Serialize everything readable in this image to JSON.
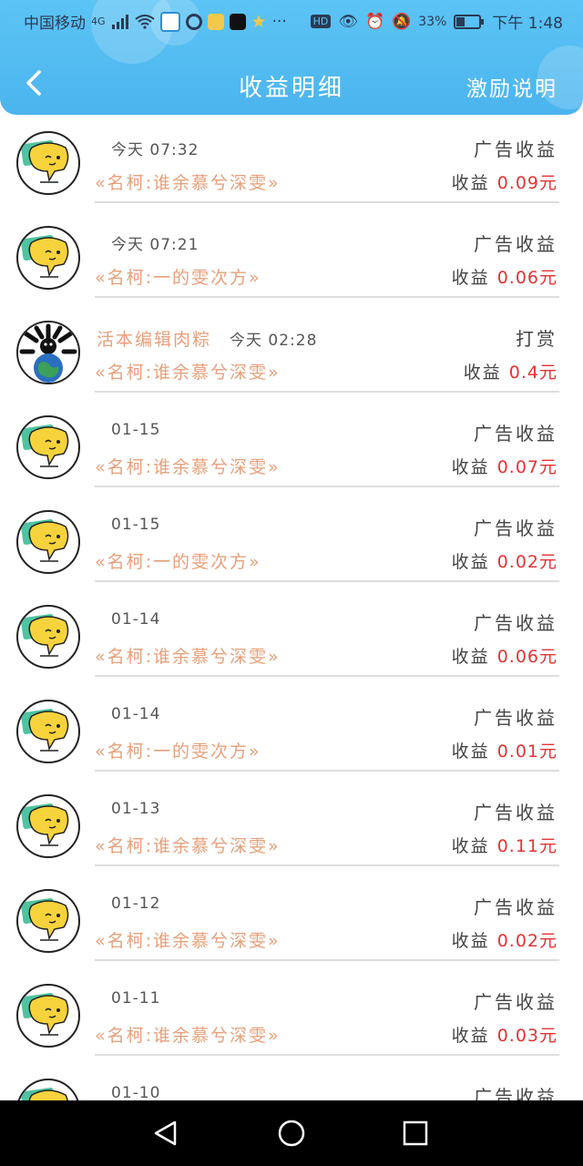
{
  "status_bar": {
    "carrier": "中国移动",
    "network": "4G",
    "battery": "33%",
    "time": "下午 1:48",
    "hd_badge": "HD"
  },
  "header": {
    "title": "收益明细",
    "explain_link": "激励说明",
    "back_icon": "chevron-left-icon",
    "color_top": "#5cc4f4",
    "color_bottom": "#4bb4ee"
  },
  "income_label": "收益",
  "amount_color": "#e23434",
  "book_color": "#e6a07a",
  "entries": [
    {
      "user": "",
      "time": "今天 07:32",
      "type": "广告收益",
      "book": "«名柯:谁余慕兮深雯»",
      "amount": "0.09元",
      "avatar": "chat-bubble-avatar"
    },
    {
      "user": "",
      "time": "今天 07:21",
      "type": "广告收益",
      "book": "«名柯:一的雯次方»",
      "amount": "0.06元",
      "avatar": "chat-bubble-avatar"
    },
    {
      "user": "活本编辑肉粽",
      "time": "今天 02:28",
      "type": "打赏",
      "book": "«名柯:谁余慕兮深雯»",
      "amount": "0.4元",
      "avatar": "earth-avatar"
    },
    {
      "user": "",
      "time": "01-15",
      "type": "广告收益",
      "book": "«名柯:谁余慕兮深雯»",
      "amount": "0.07元",
      "avatar": "chat-bubble-avatar"
    },
    {
      "user": "",
      "time": "01-15",
      "type": "广告收益",
      "book": "«名柯:一的雯次方»",
      "amount": "0.02元",
      "avatar": "chat-bubble-avatar"
    },
    {
      "user": "",
      "time": "01-14",
      "type": "广告收益",
      "book": "«名柯:谁余慕兮深雯»",
      "amount": "0.06元",
      "avatar": "chat-bubble-avatar"
    },
    {
      "user": "",
      "time": "01-14",
      "type": "广告收益",
      "book": "«名柯:一的雯次方»",
      "amount": "0.01元",
      "avatar": "chat-bubble-avatar"
    },
    {
      "user": "",
      "time": "01-13",
      "type": "广告收益",
      "book": "«名柯:谁余慕兮深雯»",
      "amount": "0.11元",
      "avatar": "chat-bubble-avatar"
    },
    {
      "user": "",
      "time": "01-12",
      "type": "广告收益",
      "book": "«名柯:谁余慕兮深雯»",
      "amount": "0.02元",
      "avatar": "chat-bubble-avatar"
    },
    {
      "user": "",
      "time": "01-11",
      "type": "广告收益",
      "book": "«名柯:谁余慕兮深雯»",
      "amount": "0.03元",
      "avatar": "chat-bubble-avatar"
    },
    {
      "user": "",
      "time": "01-10",
      "type": "广告收益",
      "book": "",
      "amount": "",
      "avatar": "chat-bubble-avatar"
    }
  ],
  "bottom_nav": {
    "back": "triangle-back-icon",
    "home": "circle-home-icon",
    "recent": "square-recent-icon"
  }
}
